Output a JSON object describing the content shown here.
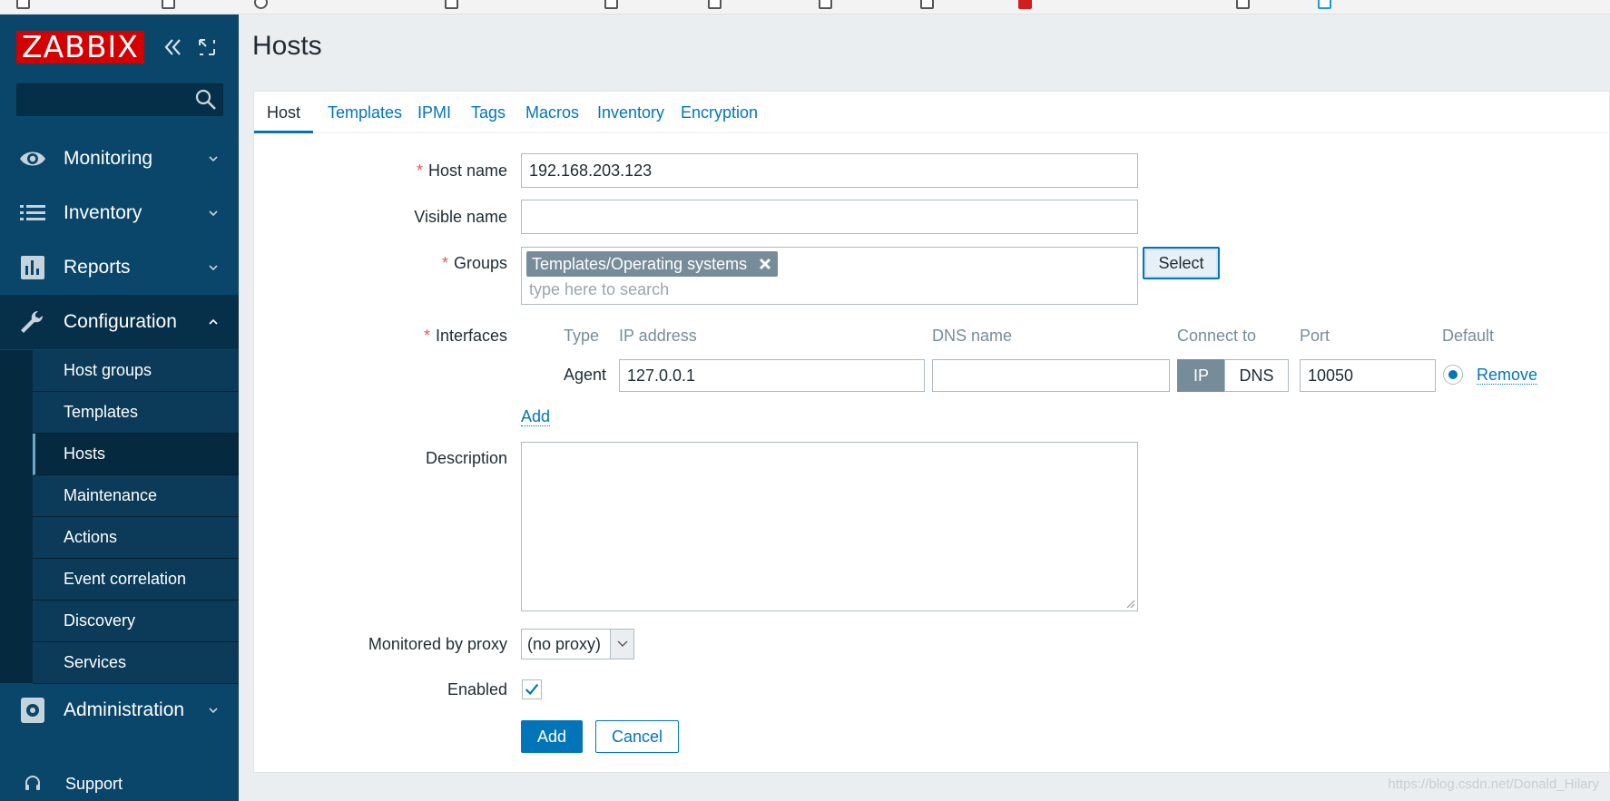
{
  "sidebar": {
    "logo": "ZABBIX",
    "search": {
      "value": ""
    },
    "menu": {
      "monitoring": "Monitoring",
      "inventory": "Inventory",
      "reports": "Reports",
      "configuration": "Configuration",
      "administration": "Administration"
    },
    "submenu": [
      "Host groups",
      "Templates",
      "Hosts",
      "Maintenance",
      "Actions",
      "Event correlation",
      "Discovery",
      "Services"
    ],
    "support": "Support"
  },
  "page": {
    "title": "Hosts"
  },
  "tabs": [
    "Host",
    "Templates",
    "IPMI",
    "Tags",
    "Macros",
    "Inventory",
    "Encryption"
  ],
  "form": {
    "required_mark": "*",
    "host_name_label": "Host name",
    "host_name_value": "192.168.203.123",
    "visible_name_label": "Visible name",
    "visible_name_value": "",
    "groups_label": "Groups",
    "groups_selected": "Templates/Operating systems",
    "groups_placeholder": "type here to search",
    "select_button": "Select",
    "interfaces_label": "Interfaces",
    "interfaces": {
      "headers": [
        "Type",
        "IP address",
        "DNS name",
        "Connect to",
        "Port",
        "Default"
      ],
      "type": "Agent",
      "ip": "127.0.0.1",
      "dns": "",
      "connect_ip": "IP",
      "connect_dns": "DNS",
      "port": "10050",
      "remove": "Remove",
      "add": "Add"
    },
    "description_label": "Description",
    "proxy_label": "Monitored by proxy",
    "proxy_value": "(no proxy)",
    "enabled_label": "Enabled",
    "enabled": true,
    "add_button": "Add",
    "cancel_button": "Cancel"
  },
  "watermark": "https://blog.csdn.net/Donald_Hilary",
  "colors": {
    "accent": "#0275b8",
    "sidebar": "#0a466a",
    "logo": "#d40000"
  }
}
